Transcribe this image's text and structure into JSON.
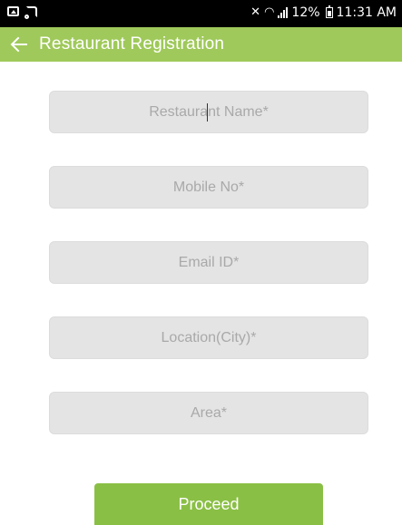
{
  "status_bar": {
    "battery_percent": "12%",
    "time": "11:31 AM",
    "icons": [
      "image-icon",
      "cast-icon",
      "mute-icon",
      "wifi-icon",
      "signal-icon",
      "battery-icon"
    ]
  },
  "app_bar": {
    "title": "Restaurant Registration",
    "back_icon": "arrow-left-icon",
    "color": "#9fc95a"
  },
  "form": {
    "restaurant_name": {
      "value": "",
      "placeholder": "Restaurant Name*"
    },
    "mobile_no": {
      "value": "",
      "placeholder": "Mobile No*"
    },
    "email_id": {
      "value": "",
      "placeholder": "Email ID*"
    },
    "location_city": {
      "value": "",
      "placeholder": "Location(City)*"
    },
    "area": {
      "value": "",
      "placeholder": "Area*"
    }
  },
  "actions": {
    "proceed_label": "Proceed",
    "button_color": "#8abf45"
  }
}
